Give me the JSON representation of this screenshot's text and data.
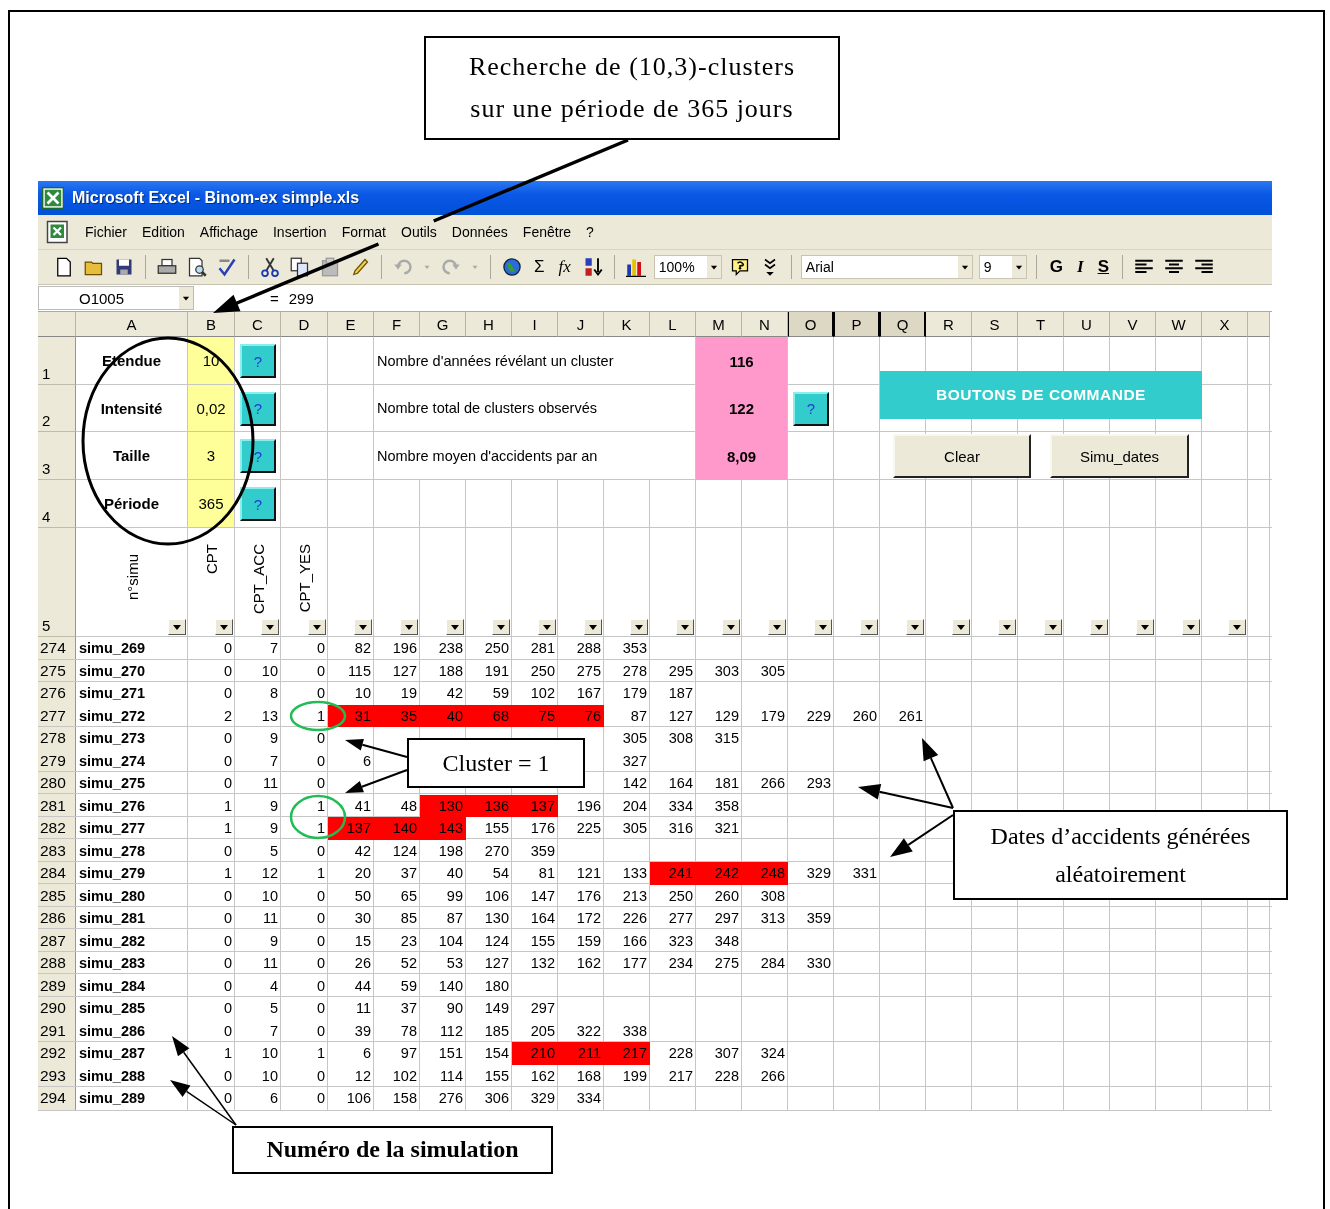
{
  "annotations": {
    "title_box": [
      "Recherche de (10,3)-clusters",
      "sur une période de 365 jours"
    ],
    "cluster_box": [
      "Cluster = 1"
    ],
    "dates_box": [
      "Dates d’accidents générées",
      "aléatoirement"
    ],
    "simulation_box": [
      "Numéro de la simulation"
    ]
  },
  "window": {
    "title": "Microsoft Excel - Binom-ex simple.xls"
  },
  "menu": [
    "Fichier",
    "Edition",
    "Affichage",
    "Insertion",
    "Format",
    "Outils",
    "Données",
    "Fenêtre",
    "?"
  ],
  "toolbar": {
    "sum": "Σ",
    "function": "fx",
    "zoom": "100%",
    "font": "Arial",
    "size": "9",
    "bold": "G",
    "italic": "I",
    "underline": "S"
  },
  "formula_bar": {
    "name_box": "O1005",
    "equals": "=",
    "value": "299"
  },
  "columns": [
    {
      "label": "A",
      "selected": false
    },
    {
      "label": "B",
      "selected": false
    },
    {
      "label": "C",
      "selected": false
    },
    {
      "label": "D",
      "selected": false
    },
    {
      "label": "E",
      "selected": false
    },
    {
      "label": "F",
      "selected": false
    },
    {
      "label": "G",
      "selected": false
    },
    {
      "label": "H",
      "selected": false
    },
    {
      "label": "I",
      "selected": false
    },
    {
      "label": "J",
      "selected": false
    },
    {
      "label": "K",
      "selected": false
    },
    {
      "label": "L",
      "selected": false
    },
    {
      "label": "M",
      "selected": false
    },
    {
      "label": "N",
      "selected": false
    },
    {
      "label": "O",
      "selected": true
    },
    {
      "label": "P",
      "selected": true
    },
    {
      "label": "Q",
      "selected": true
    },
    {
      "label": "R",
      "selected": false
    },
    {
      "label": "S",
      "selected": false
    },
    {
      "label": "T",
      "selected": false
    },
    {
      "label": "U",
      "selected": false
    },
    {
      "label": "V",
      "selected": false
    },
    {
      "label": "W",
      "selected": false
    },
    {
      "label": "X",
      "selected": false
    }
  ],
  "parameters": [
    {
      "row": "1",
      "label": "Etendue",
      "value": "10",
      "help": "?"
    },
    {
      "row": "2",
      "label": "Intensité",
      "value": "0,02",
      "help": "?"
    },
    {
      "row": "3",
      "label": "Taille",
      "value": "3",
      "help": "?"
    },
    {
      "row": "4",
      "label": "Période",
      "value": "365",
      "help": "?"
    }
  ],
  "results": [
    {
      "label": "Nombre d'années révélant un cluster",
      "value": "116"
    },
    {
      "label": "Nombre total de clusters observés",
      "value": "122",
      "help": "?"
    },
    {
      "label": "Nombre moyen d'accidents par an",
      "value": "8,09"
    }
  ],
  "command_panel": {
    "title": "BOUTONS DE COMMANDE",
    "buttons": [
      "Clear",
      "Simu_dates"
    ]
  },
  "header_row": {
    "row": "5",
    "labels": [
      "n°simu",
      "CPT",
      "CPT_ACC",
      "CPT_YES"
    ]
  },
  "rows": [
    {
      "row": "274",
      "name": "simu_269",
      "cpt": "0",
      "cpt_acc": "7",
      "cpt_yes": "0",
      "dates": [
        {
          "value": "82",
          "in_cluster": false
        },
        {
          "value": "196",
          "in_cluster": false
        },
        {
          "value": "238",
          "in_cluster": false
        },
        {
          "value": "250",
          "in_cluster": false
        },
        {
          "value": "281",
          "in_cluster": false
        },
        {
          "value": "288",
          "in_cluster": false
        },
        {
          "value": "353",
          "in_cluster": false
        }
      ]
    },
    {
      "row": "275",
      "name": "simu_270",
      "cpt": "0",
      "cpt_acc": "10",
      "cpt_yes": "0",
      "dates": [
        {
          "value": "115",
          "in_cluster": false
        },
        {
          "value": "127",
          "in_cluster": false
        },
        {
          "value": "188",
          "in_cluster": false
        },
        {
          "value": "191",
          "in_cluster": false
        },
        {
          "value": "250",
          "in_cluster": false
        },
        {
          "value": "275",
          "in_cluster": false
        },
        {
          "value": "278",
          "in_cluster": false
        },
        {
          "value": "295",
          "in_cluster": false
        },
        {
          "value": "303",
          "in_cluster": false
        },
        {
          "value": "305",
          "in_cluster": false
        }
      ]
    },
    {
      "row": "276",
      "name": "simu_271",
      "cpt": "0",
      "cpt_acc": "8",
      "cpt_yes": "0",
      "dates": [
        {
          "value": "10",
          "in_cluster": false
        },
        {
          "value": "19",
          "in_cluster": false
        },
        {
          "value": "42",
          "in_cluster": false
        },
        {
          "value": "59",
          "in_cluster": false
        },
        {
          "value": "102",
          "in_cluster": false
        },
        {
          "value": "167",
          "in_cluster": false
        },
        {
          "value": "179",
          "in_cluster": false
        },
        {
          "value": "187",
          "in_cluster": false
        }
      ]
    },
    {
      "row": "277",
      "name": "simu_272",
      "cpt": "2",
      "cpt_acc": "13",
      "cpt_yes": "1",
      "dates": [
        {
          "value": "31",
          "in_cluster": true
        },
        {
          "value": "35",
          "in_cluster": true
        },
        {
          "value": "40",
          "in_cluster": true
        },
        {
          "value": "68",
          "in_cluster": true
        },
        {
          "value": "75",
          "in_cluster": true
        },
        {
          "value": "76",
          "in_cluster": true
        },
        {
          "value": "87",
          "in_cluster": false
        },
        {
          "value": "127",
          "in_cluster": false
        },
        {
          "value": "129",
          "in_cluster": false
        },
        {
          "value": "179",
          "in_cluster": false
        },
        {
          "value": "229",
          "in_cluster": false
        },
        {
          "value": "260",
          "in_cluster": false
        },
        {
          "value": "261",
          "in_cluster": false
        }
      ]
    },
    {
      "row": "278",
      "name": "simu_273",
      "cpt": "0",
      "cpt_acc": "9",
      "cpt_yes": "0",
      "dates_after_callout": [
        {
          "value": "305",
          "in_cluster": false
        },
        {
          "value": "308",
          "in_cluster": false
        },
        {
          "value": "315",
          "in_cluster": false
        }
      ]
    },
    {
      "row": "279",
      "name": "simu_274",
      "cpt": "0",
      "cpt_acc": "7",
      "cpt_yes": "0",
      "dates": [
        {
          "value": "6",
          "in_cluster": false
        }
      ],
      "dates_after_callout": [
        {
          "value": "327",
          "in_cluster": false
        }
      ]
    },
    {
      "row": "280",
      "name": "simu_275",
      "cpt": "0",
      "cpt_acc": "11",
      "cpt_yes": "0",
      "dates_after_callout": [
        {
          "value": "142",
          "in_cluster": false
        },
        {
          "value": "164",
          "in_cluster": false
        },
        {
          "value": "181",
          "in_cluster": false
        },
        {
          "value": "266",
          "in_cluster": false
        },
        {
          "value": "293",
          "in_cluster": false
        }
      ]
    },
    {
      "row": "281",
      "name": "simu_276",
      "cpt": "1",
      "cpt_acc": "9",
      "cpt_yes": "1",
      "dates": [
        {
          "value": "41",
          "in_cluster": false
        },
        {
          "value": "48",
          "in_cluster": false
        },
        {
          "value": "130",
          "in_cluster": true
        },
        {
          "value": "136",
          "in_cluster": true
        },
        {
          "value": "137",
          "in_cluster": true
        },
        {
          "value": "196",
          "in_cluster": false
        },
        {
          "value": "204",
          "in_cluster": false
        },
        {
          "value": "334",
          "in_cluster": false
        },
        {
          "value": "358",
          "in_cluster": false
        }
      ]
    },
    {
      "row": "282",
      "name": "simu_277",
      "cpt": "1",
      "cpt_acc": "9",
      "cpt_yes": "1",
      "dates": [
        {
          "value": "137",
          "in_cluster": true
        },
        {
          "value": "140",
          "in_cluster": true
        },
        {
          "value": "143",
          "in_cluster": true
        },
        {
          "value": "155",
          "in_cluster": false
        },
        {
          "value": "176",
          "in_cluster": false
        },
        {
          "value": "225",
          "in_cluster": false
        },
        {
          "value": "305",
          "in_cluster": false
        },
        {
          "value": "316",
          "in_cluster": false
        },
        {
          "value": "321",
          "in_cluster": false
        }
      ]
    },
    {
      "row": "283",
      "name": "simu_278",
      "cpt": "0",
      "cpt_acc": "5",
      "cpt_yes": "0",
      "dates": [
        {
          "value": "42",
          "in_cluster": false
        },
        {
          "value": "124",
          "in_cluster": false
        },
        {
          "value": "198",
          "in_cluster": false
        },
        {
          "value": "270",
          "in_cluster": false
        },
        {
          "value": "359",
          "in_cluster": false
        }
      ]
    },
    {
      "row": "284",
      "name": "simu_279",
      "cpt": "1",
      "cpt_acc": "12",
      "cpt_yes": "1",
      "dates": [
        {
          "value": "20",
          "in_cluster": false
        },
        {
          "value": "37",
          "in_cluster": false
        },
        {
          "value": "40",
          "in_cluster": false
        },
        {
          "value": "54",
          "in_cluster": false
        },
        {
          "value": "81",
          "in_cluster": false
        },
        {
          "value": "121",
          "in_cluster": false
        },
        {
          "value": "133",
          "in_cluster": false
        },
        {
          "value": "241",
          "in_cluster": true
        },
        {
          "value": "242",
          "in_cluster": true
        },
        {
          "value": "248",
          "in_cluster": true
        },
        {
          "value": "329",
          "in_cluster": false
        },
        {
          "value": "331",
          "in_cluster": false
        }
      ]
    },
    {
      "row": "285",
      "name": "simu_280",
      "cpt": "0",
      "cpt_acc": "10",
      "cpt_yes": "0",
      "dates": [
        {
          "value": "50",
          "in_cluster": false
        },
        {
          "value": "65",
          "in_cluster": false
        },
        {
          "value": "99",
          "in_cluster": false
        },
        {
          "value": "106",
          "in_cluster": false
        },
        {
          "value": "147",
          "in_cluster": false
        },
        {
          "value": "176",
          "in_cluster": false
        },
        {
          "value": "213",
          "in_cluster": false
        },
        {
          "value": "250",
          "in_cluster": false
        },
        {
          "value": "260",
          "in_cluster": false
        },
        {
          "value": "308",
          "in_cluster": false
        }
      ]
    },
    {
      "row": "286",
      "name": "simu_281",
      "cpt": "0",
      "cpt_acc": "11",
      "cpt_yes": "0",
      "dates": [
        {
          "value": "30",
          "in_cluster": false
        },
        {
          "value": "85",
          "in_cluster": false
        },
        {
          "value": "87",
          "in_cluster": false
        },
        {
          "value": "130",
          "in_cluster": false
        },
        {
          "value": "164",
          "in_cluster": false
        },
        {
          "value": "172",
          "in_cluster": false
        },
        {
          "value": "226",
          "in_cluster": false
        },
        {
          "value": "277",
          "in_cluster": false
        },
        {
          "value": "297",
          "in_cluster": false
        },
        {
          "value": "313",
          "in_cluster": false
        },
        {
          "value": "359",
          "in_cluster": false
        }
      ]
    },
    {
      "row": "287",
      "name": "simu_282",
      "cpt": "0",
      "cpt_acc": "9",
      "cpt_yes": "0",
      "dates": [
        {
          "value": "15",
          "in_cluster": false
        },
        {
          "value": "23",
          "in_cluster": false
        },
        {
          "value": "104",
          "in_cluster": false
        },
        {
          "value": "124",
          "in_cluster": false
        },
        {
          "value": "155",
          "in_cluster": false
        },
        {
          "value": "159",
          "in_cluster": false
        },
        {
          "value": "166",
          "in_cluster": false
        },
        {
          "value": "323",
          "in_cluster": false
        },
        {
          "value": "348",
          "in_cluster": false
        }
      ]
    },
    {
      "row": "288",
      "name": "simu_283",
      "cpt": "0",
      "cpt_acc": "11",
      "cpt_yes": "0",
      "dates": [
        {
          "value": "26",
          "in_cluster": false
        },
        {
          "value": "52",
          "in_cluster": false
        },
        {
          "value": "53",
          "in_cluster": false
        },
        {
          "value": "127",
          "in_cluster": false
        },
        {
          "value": "132",
          "in_cluster": false
        },
        {
          "value": "162",
          "in_cluster": false
        },
        {
          "value": "177",
          "in_cluster": false
        },
        {
          "value": "234",
          "in_cluster": false
        },
        {
          "value": "275",
          "in_cluster": false
        },
        {
          "value": "284",
          "in_cluster": false
        },
        {
          "value": "330",
          "in_cluster": false
        }
      ]
    },
    {
      "row": "289",
      "name": "simu_284",
      "cpt": "0",
      "cpt_acc": "4",
      "cpt_yes": "0",
      "dates": [
        {
          "value": "44",
          "in_cluster": false
        },
        {
          "value": "59",
          "in_cluster": false
        },
        {
          "value": "140",
          "in_cluster": false
        },
        {
          "value": "180",
          "in_cluster": false
        }
      ]
    },
    {
      "row": "290",
      "name": "simu_285",
      "cpt": "0",
      "cpt_acc": "5",
      "cpt_yes": "0",
      "dates": [
        {
          "value": "11",
          "in_cluster": false
        },
        {
          "value": "37",
          "in_cluster": false
        },
        {
          "value": "90",
          "in_cluster": false
        },
        {
          "value": "149",
          "in_cluster": false
        },
        {
          "value": "297",
          "in_cluster": false
        }
      ]
    },
    {
      "row": "291",
      "name": "simu_286",
      "cpt": "0",
      "cpt_acc": "7",
      "cpt_yes": "0",
      "dates": [
        {
          "value": "39",
          "in_cluster": false
        },
        {
          "value": "78",
          "in_cluster": false
        },
        {
          "value": "112",
          "in_cluster": false
        },
        {
          "value": "185",
          "in_cluster": false
        },
        {
          "value": "205",
          "in_cluster": false
        },
        {
          "value": "322",
          "in_cluster": false
        },
        {
          "value": "338",
          "in_cluster": false
        }
      ]
    },
    {
      "row": "292",
      "name": "simu_287",
      "cpt": "1",
      "cpt_acc": "10",
      "cpt_yes": "1",
      "dates": [
        {
          "value": "6",
          "in_cluster": false
        },
        {
          "value": "97",
          "in_cluster": false
        },
        {
          "value": "151",
          "in_cluster": false
        },
        {
          "value": "154",
          "in_cluster": false
        },
        {
          "value": "210",
          "in_cluster": true
        },
        {
          "value": "211",
          "in_cluster": true
        },
        {
          "value": "217",
          "in_cluster": true
        },
        {
          "value": "228",
          "in_cluster": false
        },
        {
          "value": "307",
          "in_cluster": false
        },
        {
          "value": "324",
          "in_cluster": false
        }
      ]
    },
    {
      "row": "293",
      "name": "simu_288",
      "cpt": "0",
      "cpt_acc": "10",
      "cpt_yes": "0",
      "dates": [
        {
          "value": "12",
          "in_cluster": false
        },
        {
          "value": "102",
          "in_cluster": false
        },
        {
          "value": "114",
          "in_cluster": false
        },
        {
          "value": "155",
          "in_cluster": false
        },
        {
          "value": "162",
          "in_cluster": false
        },
        {
          "value": "168",
          "in_cluster": false
        },
        {
          "value": "199",
          "in_cluster": false
        },
        {
          "value": "217",
          "in_cluster": false
        },
        {
          "value": "228",
          "in_cluster": false
        },
        {
          "value": "266",
          "in_cluster": false
        }
      ]
    },
    {
      "row": "294",
      "name": "simu_289",
      "cpt": "0",
      "cpt_acc": "6",
      "cpt_yes": "0",
      "dates": [
        {
          "value": "106",
          "in_cluster": false
        },
        {
          "value": "158",
          "in_cluster": false
        },
        {
          "value": "276",
          "in_cluster": false
        },
        {
          "value": "306",
          "in_cluster": false
        },
        {
          "value": "329",
          "in_cluster": false
        },
        {
          "value": "334",
          "in_cluster": false
        }
      ]
    }
  ]
}
